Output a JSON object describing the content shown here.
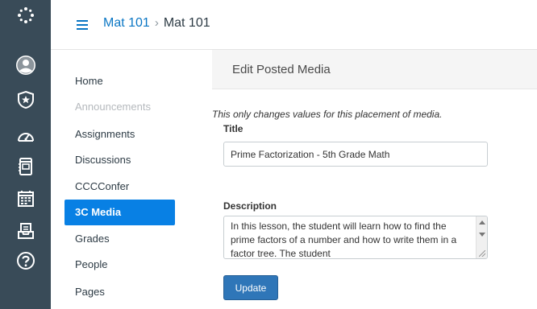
{
  "global_nav": {
    "background": "#394b58",
    "icons": [
      "logo-icon",
      "account-icon",
      "admin-icon",
      "dashboard-icon",
      "courses-icon",
      "calendar-icon",
      "inbox-icon",
      "help-icon"
    ]
  },
  "header": {
    "breadcrumb": [
      "Mat 101",
      "Mat 101"
    ],
    "separator": "›",
    "link_color": "#0a76c4"
  },
  "course_nav": {
    "items": [
      {
        "label": "Home",
        "state": "normal"
      },
      {
        "label": "Announcements",
        "state": "disabled"
      },
      {
        "label": "Assignments",
        "state": "normal"
      },
      {
        "label": "Discussions",
        "state": "normal"
      },
      {
        "label": "CCCConfer",
        "state": "normal"
      },
      {
        "label": "3C Media",
        "state": "active"
      },
      {
        "label": "Grades",
        "state": "normal"
      },
      {
        "label": "People",
        "state": "normal"
      },
      {
        "label": "Pages",
        "state": "normal"
      }
    ],
    "active_color": "#0880e4"
  },
  "content": {
    "heading": "Edit Posted Media",
    "note": "This only changes values for this placement of media.",
    "title_label": "Title",
    "title_value": "Prime Factorization - 5th Grade Math",
    "description_label": "Description",
    "description_value": "In this lesson, the student will learn how to find the prime factors of a number and how to write them in a factor tree. The student",
    "update_label": "Update",
    "button_color": "#2f76b8"
  }
}
